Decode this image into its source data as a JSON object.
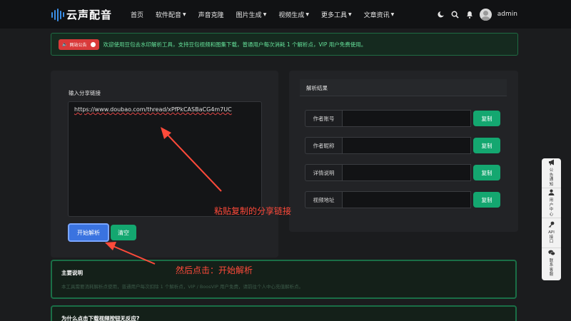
{
  "header": {
    "logo_text": "云声配音",
    "nav": [
      {
        "label": "首页",
        "dropdown": false
      },
      {
        "label": "软件配音",
        "dropdown": true
      },
      {
        "label": "声音克隆",
        "dropdown": false
      },
      {
        "label": "图片生成",
        "dropdown": true
      },
      {
        "label": "视频生成",
        "dropdown": true
      },
      {
        "label": "更多工具",
        "dropdown": true
      },
      {
        "label": "文章资讯",
        "dropdown": true
      }
    ],
    "username": "admin",
    "icons": [
      "moon-icon",
      "search-icon",
      "bell-icon",
      "avatar"
    ]
  },
  "notice": {
    "badge": "网站公告",
    "text": "欢迎使用豆包去水印解析工具，支持豆包视频和图集下载，普通用户每次消耗 1 个解析点，VIP 用户免费使用。"
  },
  "form": {
    "input_label": "输入分享链接",
    "share_url": "https://www.doubao.com/thread/xPfPkCASBaCG4m7UC",
    "parse_button": "开始解析",
    "clear_button": "清空"
  },
  "result": {
    "title": "解析结果",
    "fields": [
      {
        "label": "作者账号",
        "value": "",
        "copy": "复制"
      },
      {
        "label": "作者昵称",
        "value": "",
        "copy": "复制"
      },
      {
        "label": "详情说明",
        "value": "",
        "copy": "复制"
      },
      {
        "label": "视频地址",
        "value": "",
        "copy": "复制"
      }
    ]
  },
  "side": [
    {
      "label": "公告通知",
      "icon": "megaphone-icon",
      "glyph": "📢"
    },
    {
      "label": "用户中心",
      "icon": "user-icon",
      "glyph": "👤"
    },
    {
      "label": "API接口",
      "icon": "key-icon",
      "glyph": "🔑"
    },
    {
      "label": "联系客服",
      "icon": "chat-icon",
      "glyph": "💬"
    }
  ],
  "info": {
    "title": "主要说明",
    "text": "本工具需要消耗解析点使用，普通用户每次扣除 1 个解析点，VIP / BoosVIP 用户免费，请前往个人中心充值解析点。"
  },
  "faq": {
    "title": "为什么点击下载视频按钮无反应?"
  },
  "annotations": {
    "paste": "粘贴复制的分享链接",
    "click": "然后点击：开始解析"
  },
  "colors": {
    "accent_blue": "#3a73e0",
    "accent_green": "#14a770",
    "notice_green": "#66e39b",
    "annotation_red": "#ff4a3a"
  }
}
